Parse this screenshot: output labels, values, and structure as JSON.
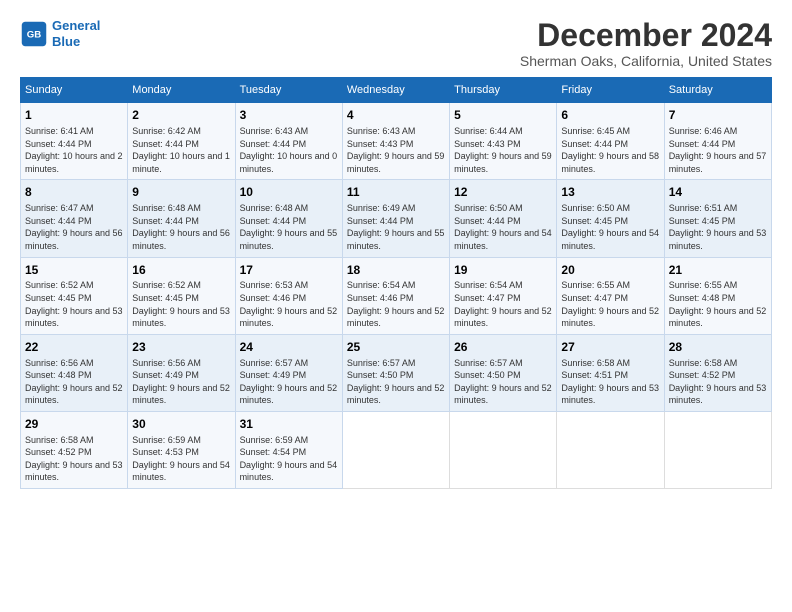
{
  "logo": {
    "line1": "General",
    "line2": "Blue"
  },
  "title": "December 2024",
  "subtitle": "Sherman Oaks, California, United States",
  "weekdays": [
    "Sunday",
    "Monday",
    "Tuesday",
    "Wednesday",
    "Thursday",
    "Friday",
    "Saturday"
  ],
  "weeks": [
    [
      {
        "day": "1",
        "sunrise": "6:41 AM",
        "sunset": "4:44 PM",
        "daylight": "10 hours and 2 minutes."
      },
      {
        "day": "2",
        "sunrise": "6:42 AM",
        "sunset": "4:44 PM",
        "daylight": "10 hours and 1 minute."
      },
      {
        "day": "3",
        "sunrise": "6:43 AM",
        "sunset": "4:44 PM",
        "daylight": "10 hours and 0 minutes."
      },
      {
        "day": "4",
        "sunrise": "6:43 AM",
        "sunset": "4:43 PM",
        "daylight": "9 hours and 59 minutes."
      },
      {
        "day": "5",
        "sunrise": "6:44 AM",
        "sunset": "4:43 PM",
        "daylight": "9 hours and 59 minutes."
      },
      {
        "day": "6",
        "sunrise": "6:45 AM",
        "sunset": "4:44 PM",
        "daylight": "9 hours and 58 minutes."
      },
      {
        "day": "7",
        "sunrise": "6:46 AM",
        "sunset": "4:44 PM",
        "daylight": "9 hours and 57 minutes."
      }
    ],
    [
      {
        "day": "8",
        "sunrise": "6:47 AM",
        "sunset": "4:44 PM",
        "daylight": "9 hours and 56 minutes."
      },
      {
        "day": "9",
        "sunrise": "6:48 AM",
        "sunset": "4:44 PM",
        "daylight": "9 hours and 56 minutes."
      },
      {
        "day": "10",
        "sunrise": "6:48 AM",
        "sunset": "4:44 PM",
        "daylight": "9 hours and 55 minutes."
      },
      {
        "day": "11",
        "sunrise": "6:49 AM",
        "sunset": "4:44 PM",
        "daylight": "9 hours and 55 minutes."
      },
      {
        "day": "12",
        "sunrise": "6:50 AM",
        "sunset": "4:44 PM",
        "daylight": "9 hours and 54 minutes."
      },
      {
        "day": "13",
        "sunrise": "6:50 AM",
        "sunset": "4:45 PM",
        "daylight": "9 hours and 54 minutes."
      },
      {
        "day": "14",
        "sunrise": "6:51 AM",
        "sunset": "4:45 PM",
        "daylight": "9 hours and 53 minutes."
      }
    ],
    [
      {
        "day": "15",
        "sunrise": "6:52 AM",
        "sunset": "4:45 PM",
        "daylight": "9 hours and 53 minutes."
      },
      {
        "day": "16",
        "sunrise": "6:52 AM",
        "sunset": "4:45 PM",
        "daylight": "9 hours and 53 minutes."
      },
      {
        "day": "17",
        "sunrise": "6:53 AM",
        "sunset": "4:46 PM",
        "daylight": "9 hours and 52 minutes."
      },
      {
        "day": "18",
        "sunrise": "6:54 AM",
        "sunset": "4:46 PM",
        "daylight": "9 hours and 52 minutes."
      },
      {
        "day": "19",
        "sunrise": "6:54 AM",
        "sunset": "4:47 PM",
        "daylight": "9 hours and 52 minutes."
      },
      {
        "day": "20",
        "sunrise": "6:55 AM",
        "sunset": "4:47 PM",
        "daylight": "9 hours and 52 minutes."
      },
      {
        "day": "21",
        "sunrise": "6:55 AM",
        "sunset": "4:48 PM",
        "daylight": "9 hours and 52 minutes."
      }
    ],
    [
      {
        "day": "22",
        "sunrise": "6:56 AM",
        "sunset": "4:48 PM",
        "daylight": "9 hours and 52 minutes."
      },
      {
        "day": "23",
        "sunrise": "6:56 AM",
        "sunset": "4:49 PM",
        "daylight": "9 hours and 52 minutes."
      },
      {
        "day": "24",
        "sunrise": "6:57 AM",
        "sunset": "4:49 PM",
        "daylight": "9 hours and 52 minutes."
      },
      {
        "day": "25",
        "sunrise": "6:57 AM",
        "sunset": "4:50 PM",
        "daylight": "9 hours and 52 minutes."
      },
      {
        "day": "26",
        "sunrise": "6:57 AM",
        "sunset": "4:50 PM",
        "daylight": "9 hours and 52 minutes."
      },
      {
        "day": "27",
        "sunrise": "6:58 AM",
        "sunset": "4:51 PM",
        "daylight": "9 hours and 53 minutes."
      },
      {
        "day": "28",
        "sunrise": "6:58 AM",
        "sunset": "4:52 PM",
        "daylight": "9 hours and 53 minutes."
      }
    ],
    [
      {
        "day": "29",
        "sunrise": "6:58 AM",
        "sunset": "4:52 PM",
        "daylight": "9 hours and 53 minutes."
      },
      {
        "day": "30",
        "sunrise": "6:59 AM",
        "sunset": "4:53 PM",
        "daylight": "9 hours and 54 minutes."
      },
      {
        "day": "31",
        "sunrise": "6:59 AM",
        "sunset": "4:54 PM",
        "daylight": "9 hours and 54 minutes."
      },
      null,
      null,
      null,
      null
    ]
  ]
}
